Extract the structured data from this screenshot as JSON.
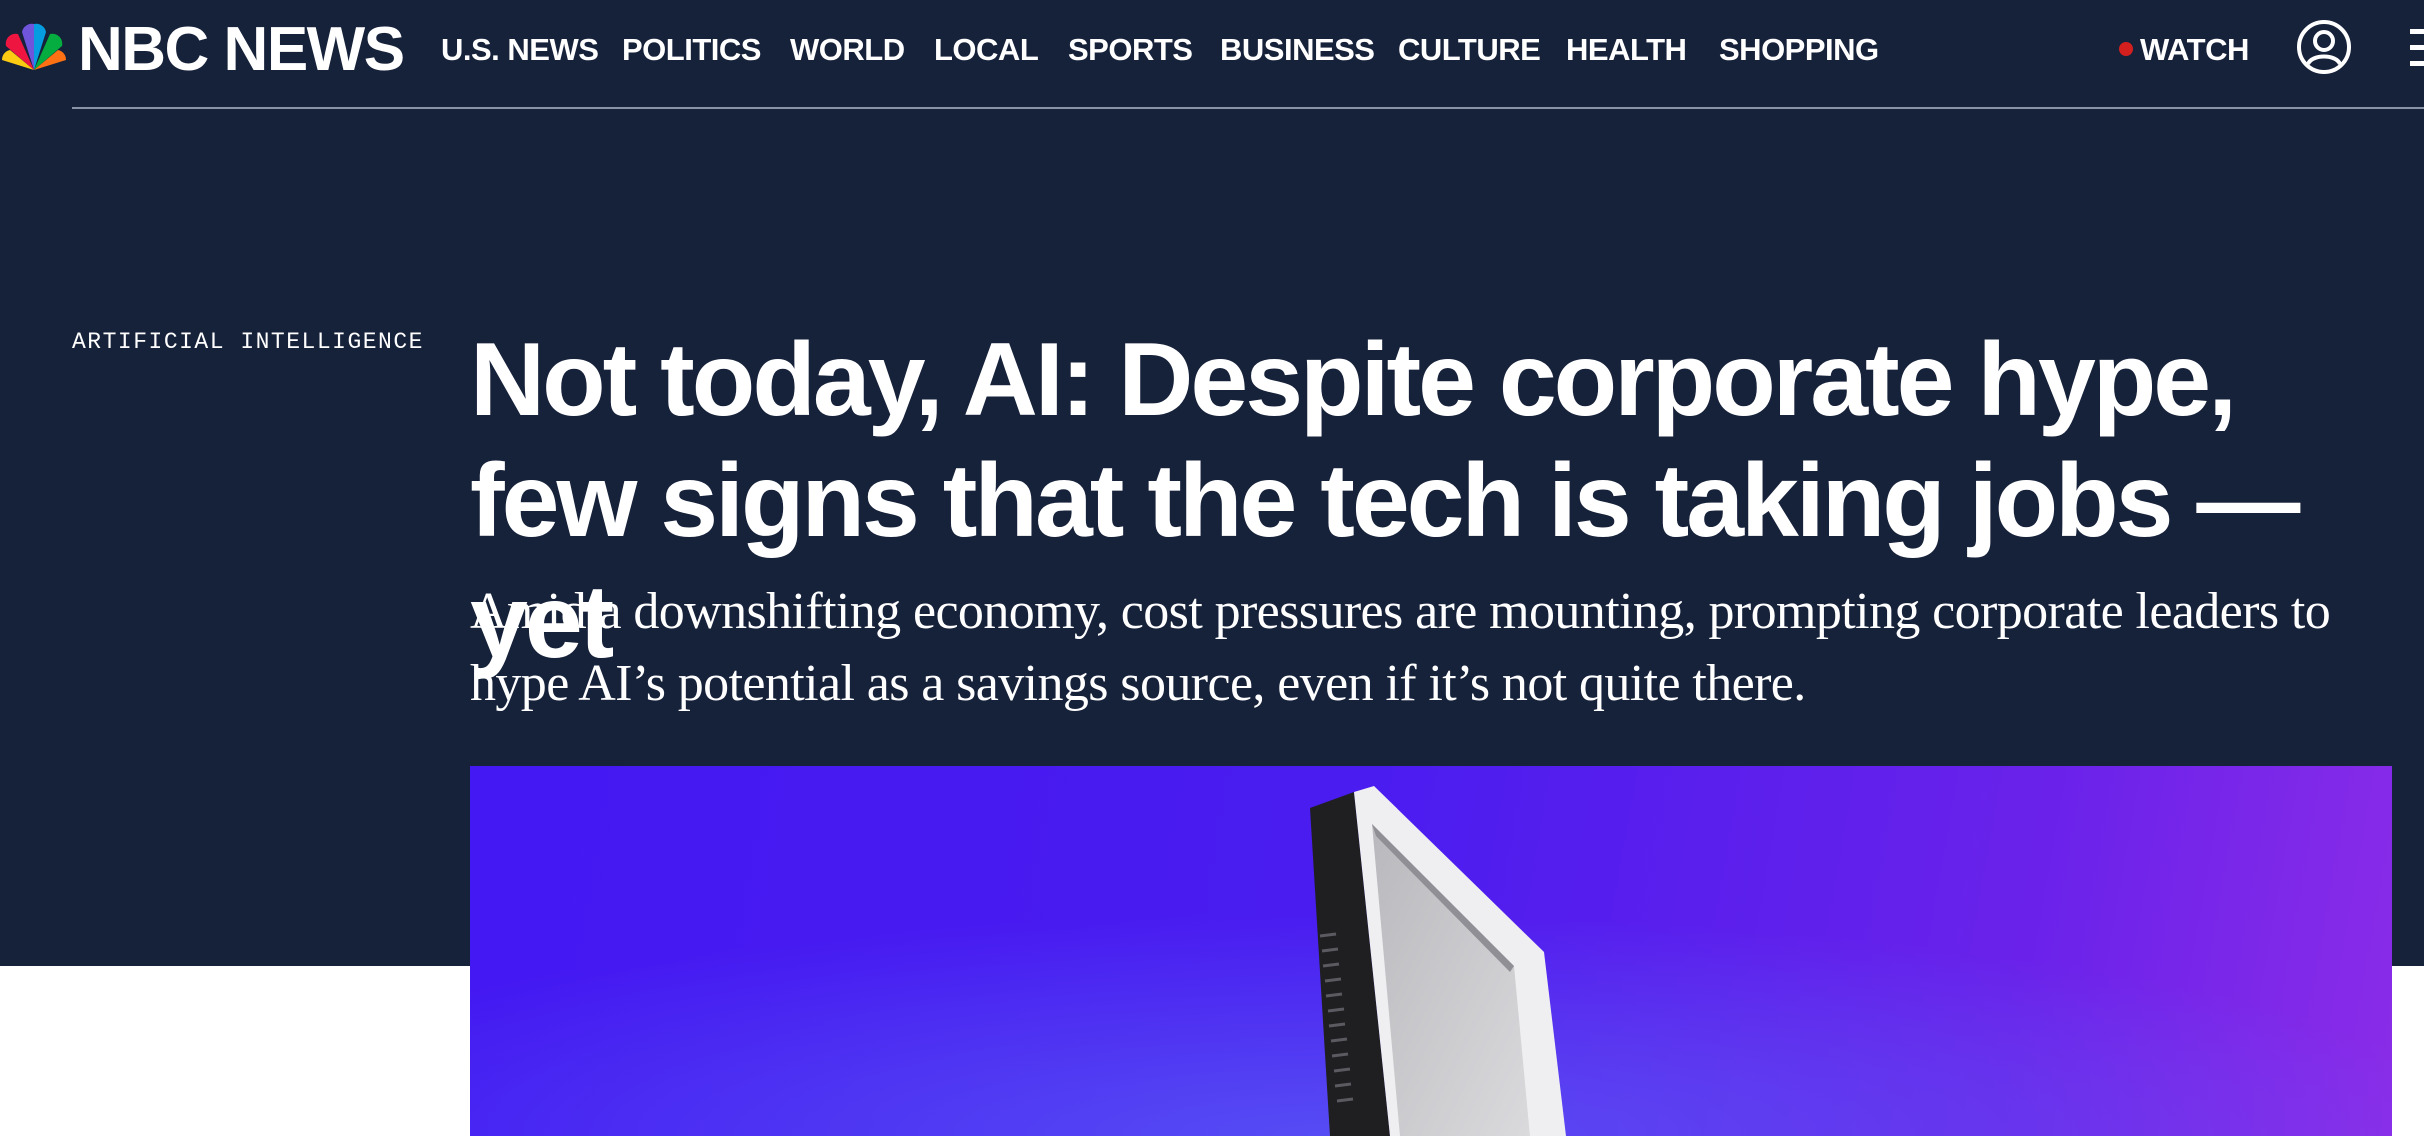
{
  "brand": {
    "name": "NBC NEWS",
    "logo_icon": "nbc-peacock-icon",
    "peacock_colors": [
      "#fccc12",
      "#ef1541",
      "#6e55dc",
      "#069de0",
      "#05ac3f",
      "#ff7112"
    ]
  },
  "nav": {
    "items": [
      "U.S. NEWS",
      "POLITICS",
      "WORLD",
      "LOCAL",
      "SPORTS",
      "BUSINESS",
      "CULTURE",
      "HEALTH",
      "SHOPPING"
    ],
    "watch_label": "WATCH",
    "live_dot_color": "#d41f1f",
    "account_icon": "account-icon",
    "menu_icon": "hamburger-menu-icon"
  },
  "article": {
    "section": "ARTIFICIAL INTELLIGENCE",
    "headline": "Not today, AI: Despite corporate hype, few signs that the tech is taking jobs — yet",
    "dek": "Amid a downshifting economy, cost pressures are mounting, prompting corporate leaders to hype AI’s potential as a savings source, even if it’s not quite there.",
    "lead_image_subject": "computer-monitor-illustration"
  },
  "colors": {
    "header_background": "#16213a",
    "text": "#ffffff",
    "image_purple": "#4a1cf0"
  }
}
